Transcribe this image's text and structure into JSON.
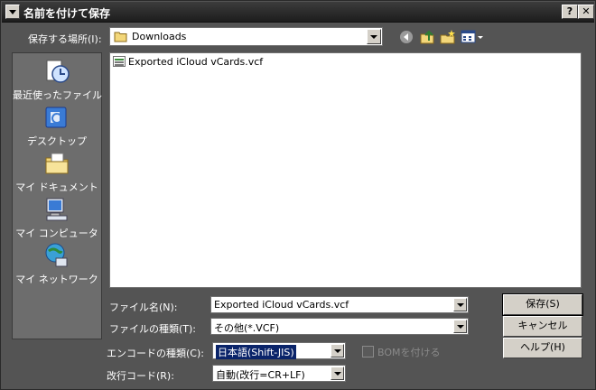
{
  "window": {
    "title": "名前を付けて保存"
  },
  "toolbar": {
    "location_label": "保存する場所(I):",
    "location_value": "Downloads"
  },
  "places": [
    {
      "label": "最近使ったファイル",
      "icon": "recent-documents-icon"
    },
    {
      "label": "デスクトップ",
      "icon": "desktop-icon"
    },
    {
      "label": "マイ ドキュメント",
      "icon": "my-documents-icon"
    },
    {
      "label": "マイ コンピュータ",
      "icon": "my-computer-icon"
    },
    {
      "label": "マイ ネットワーク",
      "icon": "my-network-icon"
    }
  ],
  "files": [
    {
      "name": "Exported iCloud vCards.vcf",
      "icon": "vcf-file-icon"
    }
  ],
  "form": {
    "filename_label": "ファイル名(N):",
    "filename_value": "Exported iCloud vCards.vcf",
    "filetype_label": "ファイルの種類(T):",
    "filetype_value": "その他(*.VCF)",
    "encoding_label": "エンコードの種類(C):",
    "encoding_value": "日本語(Shift-JIS)",
    "bom_label": "BOMを付ける",
    "newline_label": "改行コード(R):",
    "newline_value": "自動(改行=CR+LF)"
  },
  "buttons": {
    "save": "保存(S)",
    "cancel": "キャンセル",
    "help": "ヘルプ(H)"
  },
  "colors": {
    "title_bar": "#2a2a2a",
    "dialog_bg": "#545454",
    "selection": "#0a246a"
  }
}
